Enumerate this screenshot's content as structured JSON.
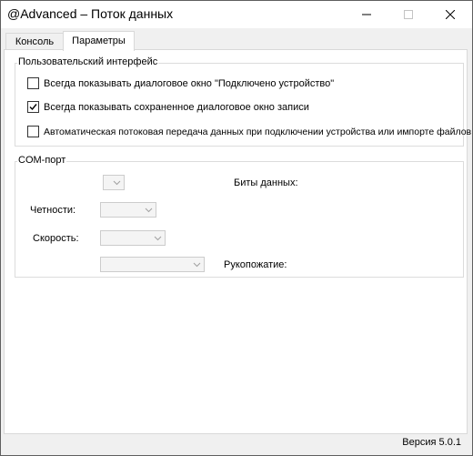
{
  "window": {
    "title": "@Advanced – Поток данных"
  },
  "tabs": [
    {
      "label": "Консоль",
      "active": false
    },
    {
      "label": "Параметры",
      "active": true
    }
  ],
  "ui_group": {
    "title": "Пользовательский интерфейс",
    "checkboxes": [
      {
        "label": "Всегда показывать диалоговое окно \"Подключено устройство\"",
        "checked": false
      },
      {
        "label": "Всегда показывать сохраненное диалоговое окно записи",
        "checked": true
      },
      {
        "label": "Автоматическая потоковая передача данных при подключении устройства или импорте файлов",
        "checked": false
      }
    ]
  },
  "com_group": {
    "title": "COM-порт",
    "data_bits_label": "Биты данных:",
    "parity_label": "Четности:",
    "speed_label": "Скорость:",
    "handshake_label": "Рукопожатие:"
  },
  "footer": {
    "version": "Версия 5.0.1"
  },
  "colors": {
    "accent": "#000000",
    "panel": "#ffffff",
    "chrome": "#f0f0f0",
    "disabled": "#6d6d6d"
  }
}
